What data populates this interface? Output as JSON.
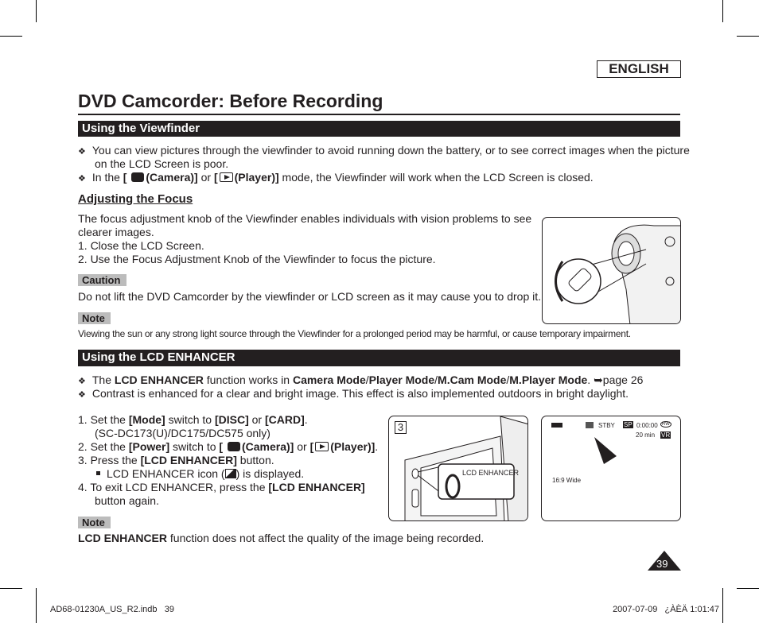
{
  "header": {
    "language": "ENGLISH",
    "title": "DVD Camcorder: Before Recording"
  },
  "viewfinder": {
    "section_title": "Using the Viewfinder",
    "bullet1_line1": "You can view pictures through the viewfinder to avoid running down the battery, or to see correct images when the picture",
    "bullet1_line2": "on the LCD Screen is poor.",
    "bullet2": {
      "pre": "In the ",
      "b1": "[ ",
      "b2": "(Camera)]",
      "or": " or ",
      "b3": "[",
      "b4": "(Player)]",
      "post": " mode, the Viewfinder will work when the LCD Screen is closed."
    },
    "focus_title": "Adjusting the Focus",
    "focus_p1": "The focus adjustment knob of the Viewfinder enables individuals with vision problems to see",
    "focus_p2": "clearer images.",
    "step1": "1.  Close the LCD Screen.",
    "step2": "2.  Use the Focus Adjustment Knob of the Viewfinder to focus the picture.",
    "caution_label": "Caution",
    "caution_text": "Do not lift the DVD Camcorder by the viewfinder or LCD screen as it may cause you to drop it.",
    "note_label": "Note",
    "note_text": "Viewing the sun or any strong light source through the Viewfinder for a prolonged period may be harmful, or cause temporary impairment."
  },
  "lcd": {
    "section_title": "Using the LCD ENHANCER",
    "b1": {
      "pre": "The ",
      "bold1": "LCD ENHANCER",
      "mid": " function works in ",
      "bold2": "Camera Mode",
      "s1": "/",
      "bold3": "Player Mode",
      "s2": "/",
      "bold4": "M.Cam Mode",
      "s3": "/",
      "bold5": "M.Player Mode",
      "post": ". ",
      "ref": "➥page 26"
    },
    "b2": "Contrast is enhanced for a clear and bright image. This effect is also implemented outdoors in bright daylight.",
    "s1": {
      "pre": "1.  Set the ",
      "b1": "[Mode]",
      "m": " switch to ",
      "b2": "[DISC]",
      "or": " or ",
      "b3": "[CARD]",
      "end": ".",
      "line2": "(SC-DC173(U)/DC175/DC575 only)"
    },
    "s2": {
      "pre": "2.  Set the ",
      "b1": "[Power]",
      "m": " switch to ",
      "b2": "[ ",
      "b3": "(Camera)]",
      "or": " or ",
      "b4": "[",
      "b5": "(Player)]",
      "end": "."
    },
    "s3": {
      "pre": "3.  Press the ",
      "b1": "[LCD ENHANCER]",
      "post": " button."
    },
    "s3_sub": {
      "pre": "LCD ENHANCER icon (",
      "post": ") is displayed."
    },
    "s4": {
      "pre": "4.  To exit LCD ENHANCER, press the ",
      "b1": "[LCD ENHANCER]",
      "line2": "button again."
    },
    "note_label": "Note",
    "note_bold": "LCD ENHANCER",
    "note_text": " function does not affect the quality of the image being recorded."
  },
  "figures": {
    "step_number": "3",
    "button_label": "LCD ENHANCER",
    "osd": {
      "status": "STBY",
      "quality": "SP",
      "time": "0:00:00",
      "disc": "RW",
      "remaining": "20 min",
      "mode": "VR",
      "aspect": "16:9 Wide"
    }
  },
  "page_number": "39",
  "footer": {
    "file": "AD68-01230A_US_R2.indb   39",
    "datetime": "2007-07-09   ¿ÀÈÄ 1:01:47"
  }
}
